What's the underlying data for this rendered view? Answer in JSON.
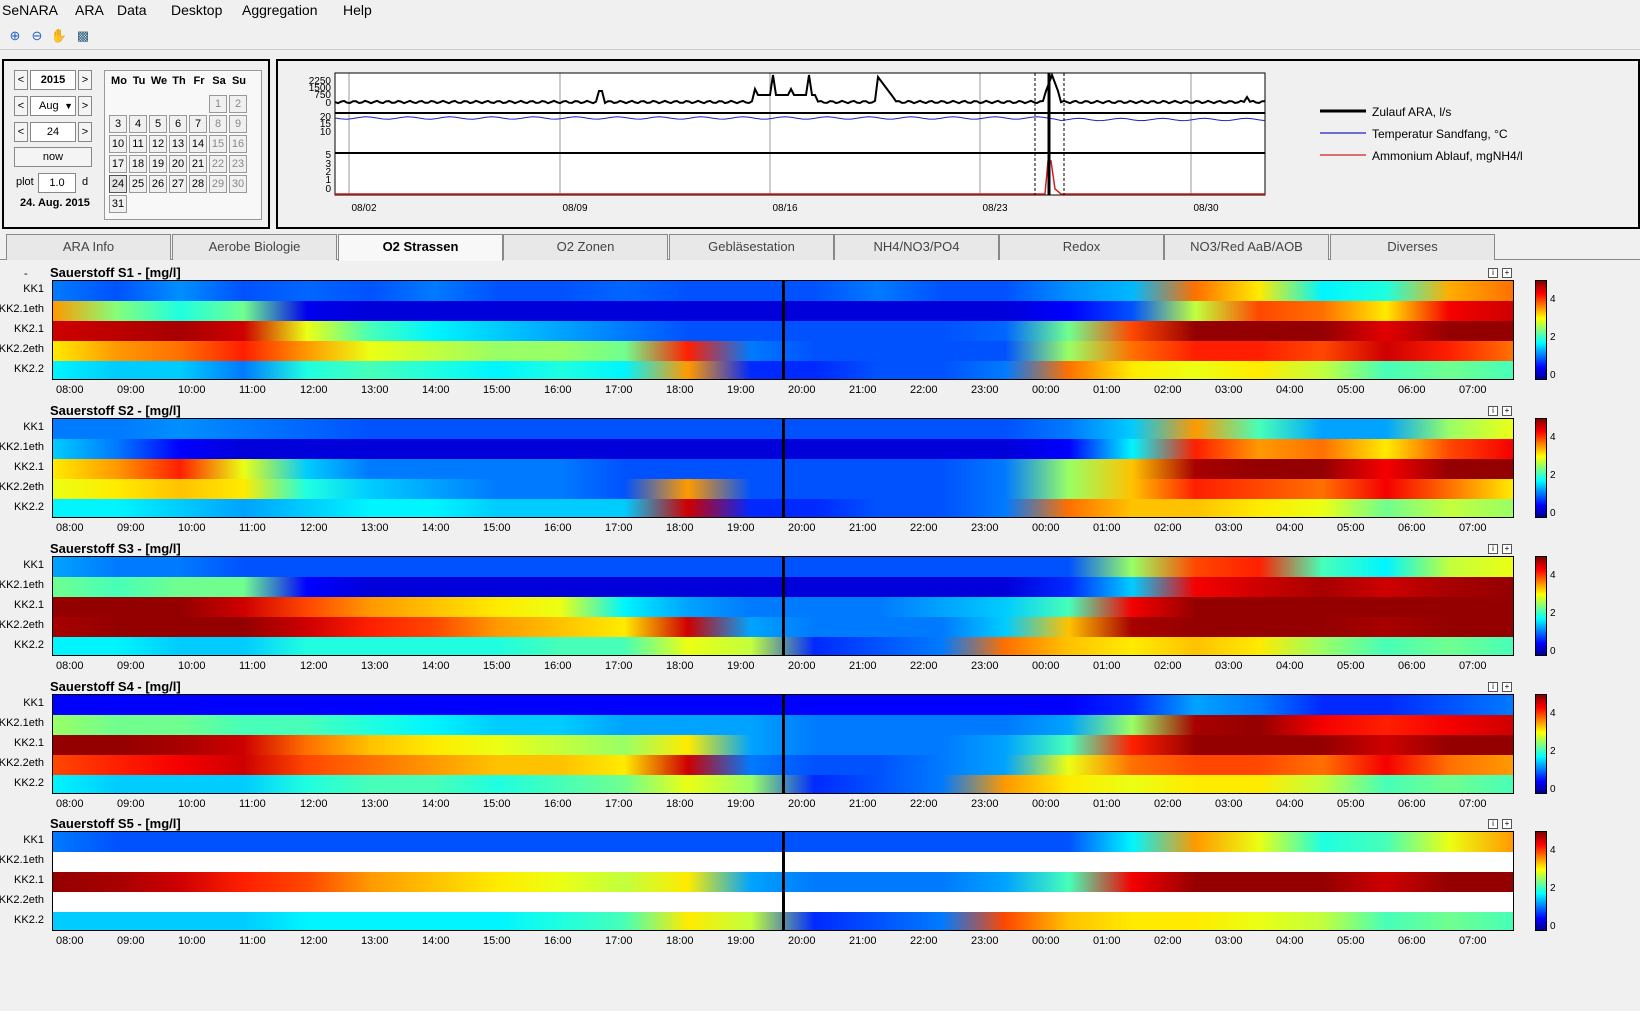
{
  "menu": [
    "SeNARA",
    "ARA",
    "Data",
    "Desktop",
    "Aggregation",
    "Help"
  ],
  "toolbar_icons": [
    "zoom-in-icon",
    "zoom-out-icon",
    "pan-hand-icon",
    "export-icon"
  ],
  "calendar": {
    "year": "2015",
    "month": "Aug",
    "day": "24",
    "now_label": "now",
    "plot_label": "plot",
    "plot_value": "1.0",
    "plot_unit": "d",
    "date_display": "24. Aug. 2015",
    "weekday_headers": [
      "Mo",
      "Tu",
      "We",
      "Th",
      "Fr",
      "Sa",
      "Su"
    ],
    "days": [
      [
        null,
        null,
        null,
        null,
        null,
        "1",
        "2"
      ],
      [
        "3",
        "4",
        "5",
        "6",
        "7",
        "8",
        "9"
      ],
      [
        "10",
        "11",
        "12",
        "13",
        "14",
        "15",
        "16"
      ],
      [
        "17",
        "18",
        "19",
        "20",
        "21",
        "22",
        "23"
      ],
      [
        "24",
        "25",
        "26",
        "27",
        "28",
        "29",
        "30"
      ],
      [
        "31",
        null,
        null,
        null,
        null,
        null,
        null
      ]
    ],
    "selected_day": "24"
  },
  "overview": {
    "yticks_top": [
      "2250",
      "1500",
      "750",
      "0"
    ],
    "yticks_mid": [
      "20",
      "15",
      "10"
    ],
    "yticks_bot": [
      "5",
      "3",
      "2",
      "1",
      "0"
    ],
    "xticks": [
      "08/02",
      "08/09",
      "08/16",
      "08/23",
      "08/30"
    ],
    "legend": [
      {
        "label": "Zulauf ARA, l/s",
        "color": "#000000"
      },
      {
        "label": "Temperatur Sandfang, °C",
        "color": "#2020c0"
      },
      {
        "label": "Ammonium Ablauf, mgNH4/l",
        "color": "#d02020"
      }
    ]
  },
  "tabs": [
    "ARA Info",
    "Aerobe Biologie",
    "O2 Strassen",
    "O2 Zonen",
    "Gebläsestation",
    "NH4/NO3/PO4",
    "Redox",
    "NO3/Red AaB/AOB",
    "Diverses"
  ],
  "active_tab": "O2 Strassen",
  "dash": "-",
  "xticks": [
    "08:00",
    "09:00",
    "10:00",
    "11:00",
    "12:00",
    "13:00",
    "14:00",
    "15:00",
    "16:00",
    "17:00",
    "18:00",
    "19:00",
    "20:00",
    "21:00",
    "22:00",
    "23:00",
    "00:00",
    "01:00",
    "02:00",
    "03:00",
    "04:00",
    "05:00",
    "06:00",
    "07:00"
  ],
  "row_labels": [
    "KK1",
    "KK2.1eth",
    "KK2.1",
    "KK2.2eth",
    "KK2.2"
  ],
  "colorbar_ticks": [
    "4",
    "2",
    "0"
  ],
  "panels": [
    {
      "title": "Sauerstoff S1 - [mg/l]"
    },
    {
      "title": "Sauerstoff S2 - [mg/l]"
    },
    {
      "title": "Sauerstoff S3 - [mg/l]"
    },
    {
      "title": "Sauerstoff S4 - [mg/l]"
    },
    {
      "title": "Sauerstoff S5 - [mg/l]"
    }
  ],
  "panel_icons": [
    "info-icon",
    "expand-icon"
  ],
  "colors": {
    "heat_low": "#00008f",
    "heat_high": "#800000",
    "marker": "#000000"
  },
  "chart_data": {
    "type": "heatmap",
    "unit": "mg/l",
    "value_range": [
      0,
      5
    ],
    "rows": [
      "KK1",
      "KK2.1eth",
      "KK2.1",
      "KK2.2eth",
      "KK2.2"
    ],
    "x": [
      "08:00",
      "09:00",
      "10:00",
      "11:00",
      "12:00",
      "13:00",
      "14:00",
      "15:00",
      "16:00",
      "17:00",
      "18:00",
      "19:00",
      "20:00",
      "21:00",
      "22:00",
      "23:00",
      "00:00",
      "01:00",
      "02:00",
      "03:00",
      "04:00",
      "05:00",
      "06:00",
      "07:00"
    ],
    "series": [
      {
        "panel": "Sauerstoff S1 - [mg/l]",
        "values": [
          [
            1.2,
            1.0,
            1.3,
            1.0,
            1.1,
            1.0,
            1.2,
            1.0,
            1.0,
            1.1,
            1.0,
            1.0,
            1.0,
            1.2,
            1.0,
            1.0,
            1.3,
            1.5,
            3.8,
            3.2,
            1.8,
            2.0,
            3.5,
            3.8
          ],
          [
            3.6,
            2.5,
            2.0,
            2.4,
            0.5,
            0.4,
            0.4,
            0.4,
            0.4,
            0.4,
            0.4,
            0.4,
            0.4,
            0.4,
            0.4,
            0.4,
            0.6,
            1.0,
            2.8,
            4.0,
            3.8,
            3.2,
            4.4,
            4.6
          ],
          [
            4.6,
            4.7,
            4.8,
            4.6,
            3.0,
            2.2,
            1.8,
            1.6,
            1.4,
            1.2,
            1.0,
            1.0,
            1.0,
            1.0,
            1.0,
            1.1,
            2.4,
            4.0,
            4.9,
            4.9,
            4.9,
            4.5,
            4.9,
            4.9
          ],
          [
            3.2,
            3.6,
            3.8,
            4.2,
            3.6,
            3.0,
            2.8,
            2.6,
            2.6,
            2.4,
            4.2,
            1.2,
            1.0,
            1.0,
            1.0,
            1.0,
            2.6,
            3.8,
            4.2,
            4.2,
            4.0,
            4.6,
            4.2,
            3.8
          ],
          [
            1.8,
            1.6,
            1.6,
            1.2,
            2.0,
            2.2,
            2.0,
            1.8,
            2.0,
            1.8,
            3.6,
            0.8,
            0.8,
            1.0,
            1.0,
            1.2,
            3.8,
            3.2,
            3.0,
            3.2,
            2.8,
            2.2,
            2.4,
            2.2
          ]
        ]
      },
      {
        "panel": "Sauerstoff S2 - [mg/l]",
        "values": [
          [
            1.2,
            1.2,
            1.3,
            1.2,
            1.1,
            1.0,
            1.0,
            1.0,
            1.0,
            1.0,
            1.0,
            1.0,
            1.0,
            1.0,
            1.0,
            1.0,
            1.2,
            1.6,
            3.6,
            2.2,
            1.4,
            1.4,
            2.6,
            3.0
          ],
          [
            1.6,
            1.2,
            0.6,
            0.4,
            0.4,
            0.4,
            0.4,
            0.4,
            0.4,
            0.4,
            0.4,
            0.4,
            0.4,
            0.4,
            0.4,
            0.4,
            0.6,
            1.8,
            4.2,
            3.6,
            3.8,
            3.2,
            4.0,
            4.4
          ],
          [
            3.2,
            3.6,
            4.2,
            3.0,
            1.6,
            1.2,
            1.2,
            1.2,
            1.2,
            1.0,
            1.0,
            1.0,
            1.0,
            1.0,
            1.0,
            1.2,
            2.6,
            3.4,
            4.8,
            4.9,
            4.9,
            4.4,
            4.9,
            4.9
          ],
          [
            3.0,
            3.2,
            3.4,
            3.2,
            2.0,
            1.6,
            1.4,
            1.2,
            1.2,
            1.0,
            3.6,
            1.0,
            1.0,
            1.0,
            1.0,
            1.2,
            2.6,
            3.4,
            4.2,
            4.0,
            3.8,
            4.4,
            3.8,
            3.2
          ],
          [
            1.8,
            1.8,
            1.6,
            1.4,
            1.6,
            1.8,
            1.8,
            1.6,
            1.6,
            1.6,
            4.6,
            0.8,
            0.8,
            1.0,
            1.0,
            1.2,
            3.8,
            3.4,
            3.4,
            3.2,
            3.0,
            2.4,
            2.8,
            2.6
          ]
        ]
      },
      {
        "panel": "Sauerstoff S3 - [mg/l]",
        "values": [
          [
            1.4,
            1.2,
            1.2,
            1.0,
            1.0,
            1.0,
            1.0,
            1.0,
            1.0,
            1.0,
            1.0,
            1.0,
            1.0,
            1.0,
            1.0,
            1.0,
            1.0,
            2.6,
            4.0,
            4.2,
            2.2,
            1.8,
            2.8,
            3.0
          ],
          [
            2.4,
            2.2,
            2.4,
            2.4,
            0.6,
            0.4,
            0.4,
            0.4,
            0.4,
            0.4,
            0.4,
            0.4,
            0.4,
            0.4,
            0.4,
            0.4,
            0.8,
            1.6,
            4.4,
            4.6,
            4.8,
            4.6,
            4.8,
            4.9
          ],
          [
            4.9,
            4.9,
            4.9,
            4.6,
            4.0,
            3.6,
            3.4,
            3.2,
            3.0,
            1.8,
            1.4,
            1.2,
            1.2,
            1.2,
            1.4,
            1.6,
            2.2,
            4.4,
            4.9,
            4.9,
            4.9,
            4.9,
            4.9,
            4.9
          ],
          [
            4.8,
            4.9,
            4.9,
            4.9,
            4.6,
            4.2,
            4.0,
            3.6,
            3.4,
            3.2,
            4.6,
            1.4,
            1.2,
            1.2,
            1.2,
            1.6,
            3.4,
            4.8,
            4.9,
            4.9,
            4.9,
            4.8,
            4.9,
            4.9
          ],
          [
            1.8,
            1.8,
            1.6,
            1.6,
            2.0,
            2.0,
            2.0,
            2.0,
            2.2,
            2.2,
            3.0,
            2.8,
            0.8,
            1.0,
            1.2,
            3.8,
            3.4,
            3.2,
            3.4,
            3.2,
            2.6,
            2.2,
            2.4,
            2.2
          ]
        ]
      },
      {
        "panel": "Sauerstoff S4 - [mg/l]",
        "values": [
          [
            0.6,
            0.6,
            0.6,
            0.6,
            0.6,
            0.6,
            0.6,
            0.6,
            0.6,
            0.6,
            0.6,
            0.6,
            0.6,
            0.6,
            0.6,
            0.6,
            0.6,
            0.8,
            1.4,
            1.2,
            0.8,
            0.8,
            1.0,
            1.2
          ],
          [
            2.6,
            2.4,
            2.4,
            2.2,
            2.2,
            2.0,
            1.8,
            1.6,
            1.6,
            1.4,
            1.4,
            1.4,
            1.2,
            1.2,
            1.2,
            1.2,
            1.4,
            2.6,
            4.8,
            4.9,
            4.4,
            4.2,
            4.4,
            4.6
          ],
          [
            4.9,
            4.9,
            4.8,
            4.6,
            3.8,
            3.4,
            3.2,
            3.0,
            2.8,
            2.6,
            3.2,
            1.4,
            1.2,
            1.2,
            1.2,
            1.4,
            2.2,
            4.2,
            4.9,
            4.9,
            4.9,
            4.6,
            4.9,
            4.9
          ],
          [
            4.0,
            4.2,
            4.4,
            4.6,
            4.0,
            3.8,
            3.6,
            3.4,
            3.4,
            3.2,
            4.6,
            1.2,
            1.0,
            1.0,
            1.2,
            1.4,
            3.0,
            3.8,
            4.0,
            4.0,
            3.8,
            4.4,
            3.8,
            3.6
          ],
          [
            1.8,
            1.6,
            1.6,
            1.6,
            2.0,
            2.2,
            2.2,
            2.0,
            2.2,
            2.4,
            3.0,
            2.6,
            0.8,
            1.0,
            1.2,
            3.6,
            3.2,
            3.0,
            3.2,
            3.2,
            2.8,
            2.2,
            2.4,
            2.2
          ]
        ]
      },
      {
        "panel": "Sauerstoff S5 - [mg/l]",
        "values": [
          [
            1.2,
            1.0,
            1.0,
            1.0,
            1.0,
            1.0,
            1.0,
            1.0,
            1.0,
            1.0,
            1.0,
            1.0,
            1.0,
            1.0,
            1.0,
            1.0,
            1.0,
            1.8,
            3.6,
            3.0,
            2.0,
            2.2,
            3.0,
            3.6
          ],
          [
            null,
            null,
            null,
            null,
            null,
            null,
            null,
            null,
            null,
            null,
            null,
            null,
            null,
            null,
            null,
            null,
            null,
            null,
            null,
            null,
            null,
            null,
            null,
            null
          ],
          [
            4.9,
            4.8,
            4.6,
            4.2,
            4.0,
            3.6,
            3.4,
            3.2,
            3.0,
            2.8,
            3.2,
            1.4,
            1.2,
            1.2,
            1.2,
            1.4,
            2.2,
            4.4,
            4.9,
            4.9,
            4.9,
            4.6,
            4.9,
            4.9
          ],
          [
            null,
            null,
            null,
            null,
            null,
            null,
            null,
            null,
            null,
            null,
            null,
            null,
            null,
            null,
            null,
            null,
            null,
            null,
            null,
            null,
            null,
            null,
            null,
            null
          ],
          [
            1.6,
            1.6,
            1.6,
            1.6,
            1.8,
            1.8,
            1.8,
            1.8,
            2.0,
            2.2,
            3.2,
            2.8,
            0.8,
            1.0,
            1.2,
            4.0,
            3.4,
            3.2,
            3.2,
            3.0,
            2.8,
            2.2,
            2.4,
            2.2
          ]
        ]
      }
    ],
    "marker_time": "19:40",
    "marker_x_fraction": 0.5
  }
}
